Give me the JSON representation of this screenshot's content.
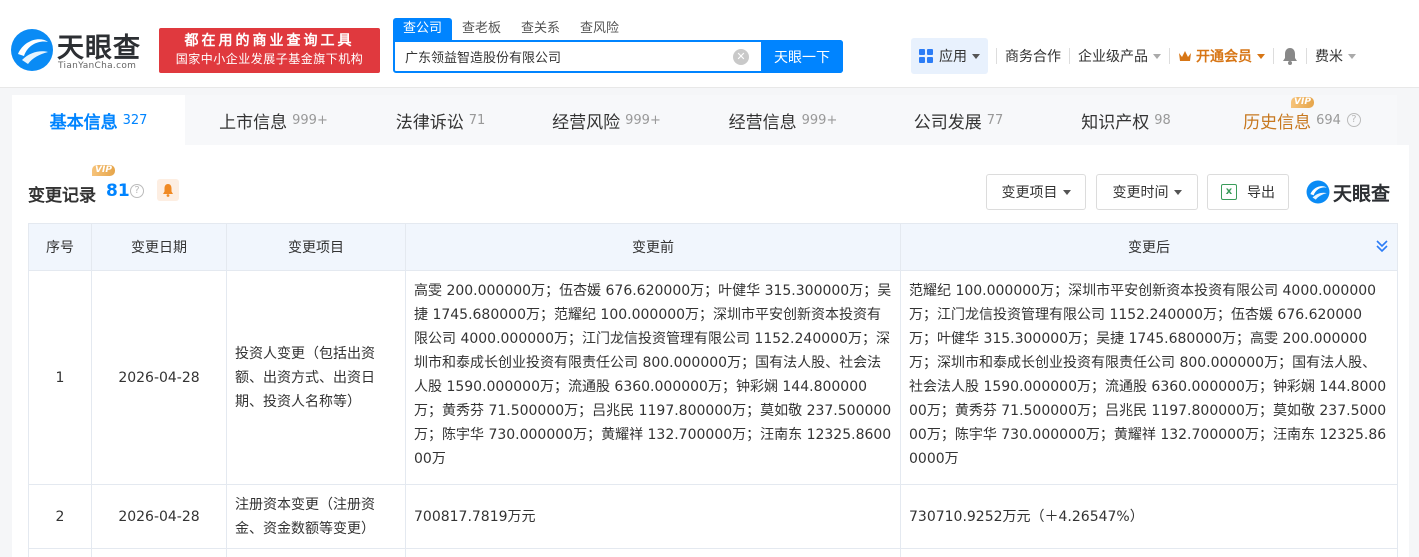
{
  "header": {
    "logo_text": "天眼查",
    "logo_sub": "TianYanCha.com",
    "slogan_line1": "都在用的商业查询工具",
    "slogan_line2": "国家中小企业发展子基金旗下机构",
    "search_tabs": [
      "查公司",
      "查老板",
      "查关系",
      "查风险"
    ],
    "search_value": "广东领益智造股份有限公司",
    "search_button": "天眼一下",
    "app_label": "应用",
    "nav_business": "商务合作",
    "nav_enterprise": "企业级产品",
    "nav_vip": "开通会员",
    "user_name": "费米"
  },
  "tabs": [
    {
      "label": "基本信息",
      "count": "327"
    },
    {
      "label": "上市信息",
      "count": "999+"
    },
    {
      "label": "法律诉讼",
      "count": "71"
    },
    {
      "label": "经营风险",
      "count": "999+"
    },
    {
      "label": "经营信息",
      "count": "999+"
    },
    {
      "label": "公司发展",
      "count": "77"
    },
    {
      "label": "知识产权",
      "count": "98"
    },
    {
      "label": "历史信息",
      "count": "694"
    }
  ],
  "vip_badge": "VIP",
  "section": {
    "title": "变更记录",
    "count": "81",
    "filter_item": "变更项目",
    "filter_time": "变更时间",
    "export": "导出",
    "brand": "天眼查"
  },
  "table": {
    "headers": [
      "序号",
      "变更日期",
      "变更项目",
      "变更前",
      "变更后"
    ],
    "rows": [
      {
        "index": "1",
        "date": "2026-04-28",
        "item": "投资人变更（包括出资额、出资方式、出资日期、投资人名称等）",
        "before": "高雯 200.000000万；伍杏媛 676.620000万；叶健华 315.300000万；吴捷 1745.680000万；范耀纪 100.000000万；深圳市平安创新资本投资有限公司 4000.000000万；江门龙信投资管理有限公司 1152.240000万；深圳市和泰成长创业投资有限责任公司 800.000000万；国有法人股、社会法人股 1590.000000万；流通股 6360.000000万；钟彩娴 144.800000万；黄秀芬 71.500000万；吕兆民 1197.800000万；莫如敬 237.500000万；陈宇华 730.000000万；黄耀祥 132.700000万；汪南东 12325.860000万",
        "after": "范耀纪 100.000000万；深圳市平安创新资本投资有限公司 4000.000000万；江门龙信投资管理有限公司 1152.240000万；伍杏媛 676.620000万；叶健华 315.300000万；吴捷 1745.680000万；高雯 200.000000万；深圳市和泰成长创业投资有限责任公司 800.000000万；国有法人股、社会法人股 1590.000000万；流通股 6360.000000万；钟彩娴 144.800000万；黄秀芬 71.500000万；吕兆民 1197.800000万；莫如敬 237.500000万；陈宇华 730.000000万；黄耀祥 132.700000万；汪南东 12325.860000万"
      },
      {
        "index": "2",
        "date": "2026-04-28",
        "item": "注册资本变更（注册资金、资金数额等变更）",
        "before": "700817.7819万元",
        "after": "730710.9252万元（＋4.26547%）"
      }
    ]
  },
  "colors": {
    "accent": "#0084ff",
    "slogan_bg": "#e0393e",
    "vip_text": "#d77616",
    "increase": "#e84a3a"
  }
}
